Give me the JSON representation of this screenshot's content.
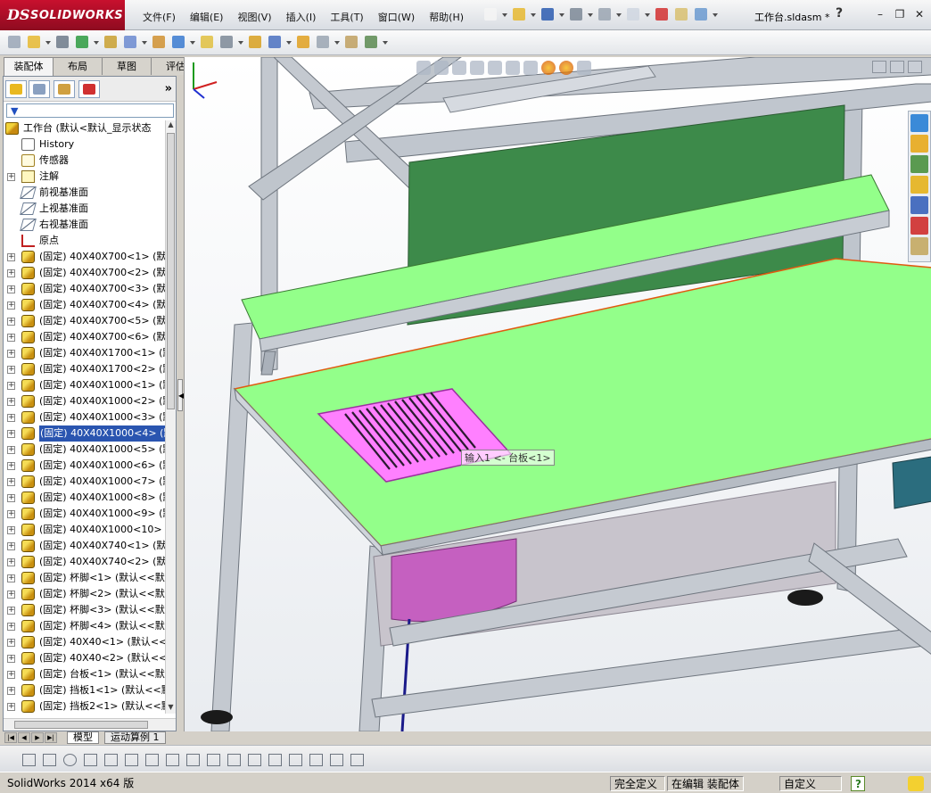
{
  "app": {
    "logo_ds": "DS",
    "logo_text": "SOLIDWORKS",
    "document_title": "工作台.sldasm *",
    "help_label": "?",
    "win_min": "–",
    "win_restore": "❐",
    "win_close": "✕"
  },
  "menu": [
    "文件(F)",
    "编辑(E)",
    "视图(V)",
    "插入(I)",
    "工具(T)",
    "窗口(W)",
    "帮助(H)"
  ],
  "command_tabs": [
    {
      "label": "装配体",
      "active": true
    },
    {
      "label": "布局",
      "active": false
    },
    {
      "label": "草图",
      "active": false
    },
    {
      "label": "评估",
      "active": false
    }
  ],
  "feature_manager": {
    "more_label": "»",
    "filter_icon": "▼",
    "root": "工作台  (默认<默认_显示状态",
    "items": [
      {
        "label": "History",
        "icon": "history",
        "expand": ""
      },
      {
        "label": "传感器",
        "icon": "sensor",
        "expand": ""
      },
      {
        "label": "注解",
        "icon": "annotation",
        "expand": "+"
      },
      {
        "label": "前视基准面",
        "icon": "plane",
        "expand": ""
      },
      {
        "label": "上视基准面",
        "icon": "plane",
        "expand": ""
      },
      {
        "label": "右视基准面",
        "icon": "plane",
        "expand": ""
      },
      {
        "label": "原点",
        "icon": "origin",
        "expand": ""
      },
      {
        "label": "(固定) 40X40X700<1> (默认",
        "icon": "part",
        "expand": "+"
      },
      {
        "label": "(固定) 40X40X700<2> (默认",
        "icon": "part",
        "expand": "+"
      },
      {
        "label": "(固定) 40X40X700<3> (默认",
        "icon": "part",
        "expand": "+"
      },
      {
        "label": "(固定) 40X40X700<4> (默认",
        "icon": "part",
        "expand": "+"
      },
      {
        "label": "(固定) 40X40X700<5> (默认",
        "icon": "part",
        "expand": "+"
      },
      {
        "label": "(固定) 40X40X700<6> (默认",
        "icon": "part",
        "expand": "+"
      },
      {
        "label": "(固定) 40X40X1700<1> (默",
        "icon": "part",
        "expand": "+"
      },
      {
        "label": "(固定) 40X40X1700<2> (默",
        "icon": "part",
        "expand": "+"
      },
      {
        "label": "(固定) 40X40X1000<1> (默",
        "icon": "part",
        "expand": "+"
      },
      {
        "label": "(固定) 40X40X1000<2> (默",
        "icon": "part",
        "expand": "+"
      },
      {
        "label": "(固定) 40X40X1000<3> (默",
        "icon": "part",
        "expand": "+"
      },
      {
        "label": "(固定) 40X40X1000<4> (默",
        "icon": "part",
        "expand": "+",
        "selected": true
      },
      {
        "label": "(固定) 40X40X1000<5> (默",
        "icon": "part",
        "expand": "+"
      },
      {
        "label": "(固定) 40X40X1000<6> (默",
        "icon": "part",
        "expand": "+"
      },
      {
        "label": "(固定) 40X40X1000<7> (默",
        "icon": "part",
        "expand": "+"
      },
      {
        "label": "(固定) 40X40X1000<8> (默",
        "icon": "part",
        "expand": "+"
      },
      {
        "label": "(固定) 40X40X1000<9> (默",
        "icon": "part",
        "expand": "+"
      },
      {
        "label": "(固定) 40X40X1000<10> (默",
        "icon": "part",
        "expand": "+"
      },
      {
        "label": "(固定) 40X40X740<1> (默认",
        "icon": "part",
        "expand": "+"
      },
      {
        "label": "(固定) 40X40X740<2> (默认",
        "icon": "part",
        "expand": "+"
      },
      {
        "label": "(固定) 杯脚<1> (默认<<默",
        "icon": "part",
        "expand": "+"
      },
      {
        "label": "(固定) 杯脚<2> (默认<<默",
        "icon": "part",
        "expand": "+"
      },
      {
        "label": "(固定) 杯脚<3> (默认<<默",
        "icon": "part",
        "expand": "+"
      },
      {
        "label": "(固定) 杯脚<4> (默认<<默",
        "icon": "part",
        "expand": "+"
      },
      {
        "label": "(固定) 40X40<1> (默认<<默",
        "icon": "part",
        "expand": "+"
      },
      {
        "label": "(固定) 40X40<2> (默认<<默",
        "icon": "part",
        "expand": "+"
      },
      {
        "label": "(固定) 台板<1> (默认<<默",
        "icon": "part",
        "expand": "+"
      },
      {
        "label": "(固定) 挡板1<1> (默认<<默",
        "icon": "part",
        "expand": "+"
      },
      {
        "label": "(固定) 挡板2<1> (默认<<默",
        "icon": "part",
        "expand": "+"
      }
    ]
  },
  "viewport": {
    "callout": "输入1 <- 台板<1>"
  },
  "bottom_tabs": [
    {
      "label": "模型",
      "active": true
    },
    {
      "label": "运动算例 1",
      "active": false
    }
  ],
  "status": {
    "version": "SolidWorks 2014 x64 版",
    "definition": "完全定义",
    "editing": "在编辑 装配体",
    "units": "自定义",
    "help": "?"
  },
  "colors": {
    "table_top": "#93ff8a",
    "back_panel": "#3d8a4a",
    "pink_grille": "#ff80ff",
    "bin": "#c560c0",
    "frame": "#b9bfc8",
    "selection": "#2a55b0"
  }
}
